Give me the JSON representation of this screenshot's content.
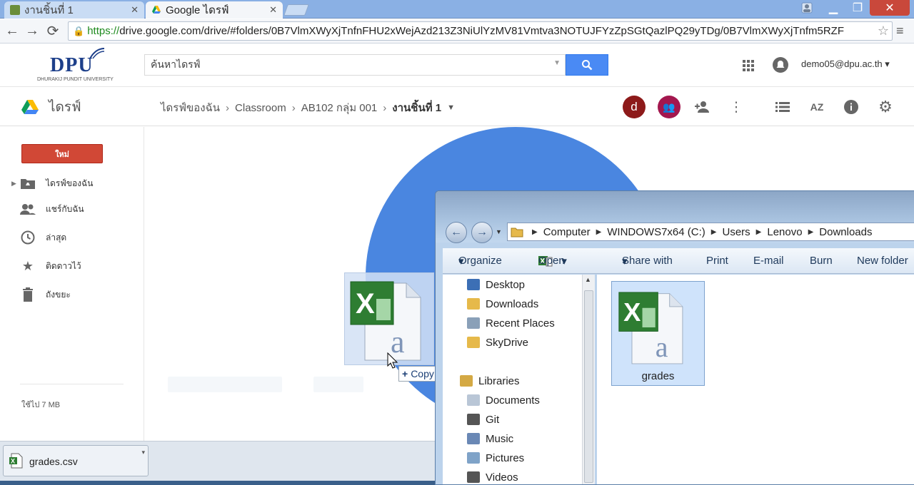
{
  "browser": {
    "tabs": [
      {
        "title": "งานชิ้นที่ 1",
        "active": false
      },
      {
        "title": "Google ไดรฟ์",
        "active": true
      }
    ],
    "url_https": "https://",
    "url_rest": "drive.google.com/drive/#folders/0B7VlmXWyXjTnfnFHU2xWejAzd213Z3NiUlYzMV81Vmtva3NOTUJFYzZpSGtQazlPQ29yTDg/0B7VlmXWyXjTnfm5RZF"
  },
  "drive": {
    "logo_text": "DPU",
    "logo_subtext": "DHURAKIJ PUNDIT UNIVERSITY",
    "search_placeholder": "ค้นหาไดรฟ์",
    "account_email": "demo05@dpu.ac.th",
    "app_title": "ไดรฟ์",
    "breadcrumb": [
      "ไดรฟ์ของฉัน",
      "Classroom",
      "AB102 กลุ่ม 001",
      "งานชิ้นที่ 1"
    ],
    "avatar_letter": "d",
    "new_button": "ใหม่",
    "nav": [
      "ไดรฟ์ของฉัน",
      "แชร์กับฉัน",
      "ล่าสุด",
      "ติดดาวไว้",
      "ถังขยะ"
    ],
    "storage": "ใช้ไป 7 MB",
    "drag_tooltip": "Copy",
    "brand_color": "#4a86e0",
    "new_button_color": "#d14836"
  },
  "downloads": {
    "file": "grades.csv"
  },
  "explorer": {
    "address": [
      "Computer",
      "WINDOWS7x64 (C:)",
      "Users",
      "Lenovo",
      "Downloads"
    ],
    "toolbar": [
      "Organize",
      "Open",
      "Share with",
      "Print",
      "E-mail",
      "Burn",
      "New folder"
    ],
    "favorites": [
      "Desktop",
      "Downloads",
      "Recent Places",
      "SkyDrive"
    ],
    "libraries_label": "Libraries",
    "libraries": [
      "Documents",
      "Git",
      "Music",
      "Pictures",
      "Videos"
    ],
    "file_name": "grades"
  }
}
